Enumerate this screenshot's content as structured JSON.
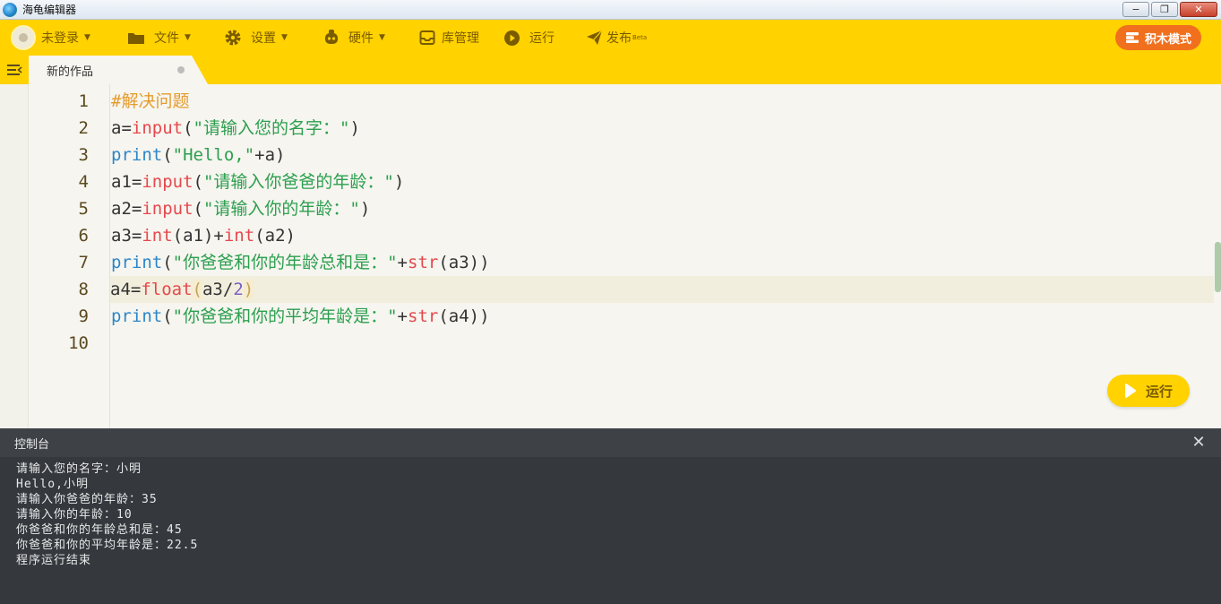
{
  "window": {
    "title": "海龟编辑器",
    "buttons": {
      "minimize": "−",
      "restore": "❐",
      "close": "✕"
    }
  },
  "toolbar": {
    "login": "未登录",
    "file": "文件",
    "settings": "设置",
    "hardware": "硬件",
    "library": "库管理",
    "run": "运行",
    "publish": "发布",
    "publish_badge": "Beta",
    "block_mode": "积木模式",
    "accent": "#ffd200"
  },
  "tabs": [
    {
      "label": "新的作品",
      "modified": true
    }
  ],
  "editor": {
    "line_numbers": [
      "1",
      "2",
      "3",
      "4",
      "5",
      "6",
      "7",
      "8",
      "9",
      "10"
    ],
    "active_line": 8,
    "lines": {
      "l1": {
        "comment": "#解决问题"
      },
      "l2": {
        "a": "a=",
        "fn": "input",
        "p1": "(",
        "s": "\"请输入您的名字：\"",
        "p2": ")"
      },
      "l3": {
        "fn": "print",
        "p1": "(",
        "s": "\"Hello,\"",
        "rest": "+a)"
      },
      "l4": {
        "a": "a1=",
        "fn": "input",
        "p1": "(",
        "s": "\"请输入你爸爸的年龄：\"",
        "p2": ")"
      },
      "l5": {
        "a": "a2=",
        "fn": "input",
        "p1": "(",
        "s": "\"请输入你的年龄：\"",
        "p2": ")"
      },
      "l6": {
        "a": "a3=",
        "fn1": "int",
        "m1": "(a1)+",
        "fn2": "int",
        "m2": "(a2)"
      },
      "l7": {
        "fn": "print",
        "p1": "(",
        "s": "\"你爸爸和你的年龄总和是：\"",
        "m": "+",
        "fn2": "str",
        "rest": "(a3))"
      },
      "l8": {
        "a": "a4=",
        "fn": "float",
        "p1": "(",
        "m": "a3/",
        "num": "2",
        "p2": ")"
      },
      "l9": {
        "fn": "print",
        "p1": "(",
        "s": "\"你爸爸和你的平均年龄是：\"",
        "m": "+",
        "fn2": "str",
        "rest": "(a4))"
      }
    },
    "run_button": "运行"
  },
  "console": {
    "title": "控制台",
    "close": "✕",
    "output": [
      "请输入您的名字：小明",
      "Hello,小明",
      "请输入你爸爸的年龄：35",
      "请输入你的年龄：10",
      "你爸爸和你的年龄总和是：45",
      "你爸爸和你的平均年龄是：22.5",
      "程序运行结束"
    ]
  }
}
